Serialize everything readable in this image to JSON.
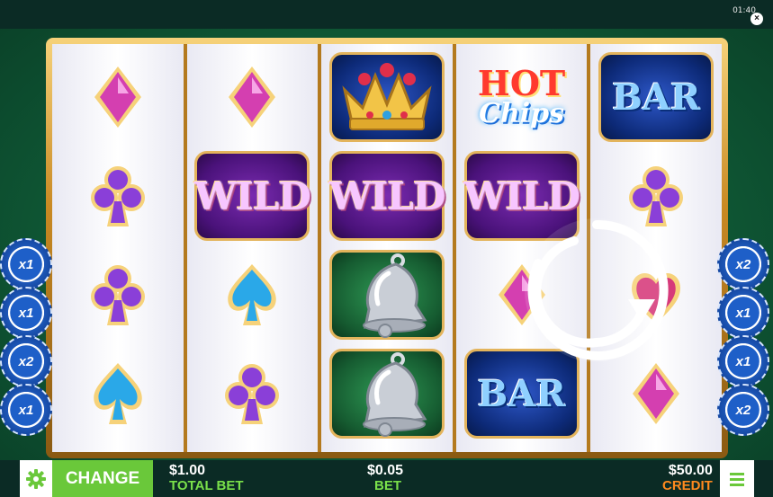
{
  "status": {
    "clock": "01:40",
    "close_glyph": "×"
  },
  "reels": [
    [
      "diamond",
      "club",
      "club",
      "spade"
    ],
    [
      "diamond",
      "wild",
      "spade",
      "club"
    ],
    [
      "crown",
      "wild",
      "bell",
      "bell"
    ],
    [
      "hotchips",
      "wild",
      "diamond",
      "bar"
    ],
    [
      "bar",
      "club",
      "heart",
      "diamond"
    ]
  ],
  "symbols": {
    "wild_text": "WILD",
    "bar_text": "BAR",
    "hot_text": "HOT",
    "chips_text": "Chips"
  },
  "left_chips": [
    "x1",
    "x1",
    "x2",
    "x1"
  ],
  "right_chips": [
    "x2",
    "x1",
    "x1",
    "x2"
  ],
  "bottom": {
    "change_label": "CHANGE",
    "total_bet_value": "$1.00",
    "total_bet_label": "TOTAL BET",
    "bet_value": "$0.05",
    "bet_label": "BET",
    "credit_value": "$50.00",
    "credit_label": "CREDIT"
  },
  "colors": {
    "felt": "#1f7a4c",
    "gold_frame": "#c98a23",
    "change_green": "#6ac83a",
    "label_green": "#7ae04a",
    "credit_orange": "#ff8a1e",
    "diamond": "#d43fb0",
    "club": "#8a3fd8",
    "spade_blue": "#2aa8e8",
    "heart": "#d63a7a"
  }
}
